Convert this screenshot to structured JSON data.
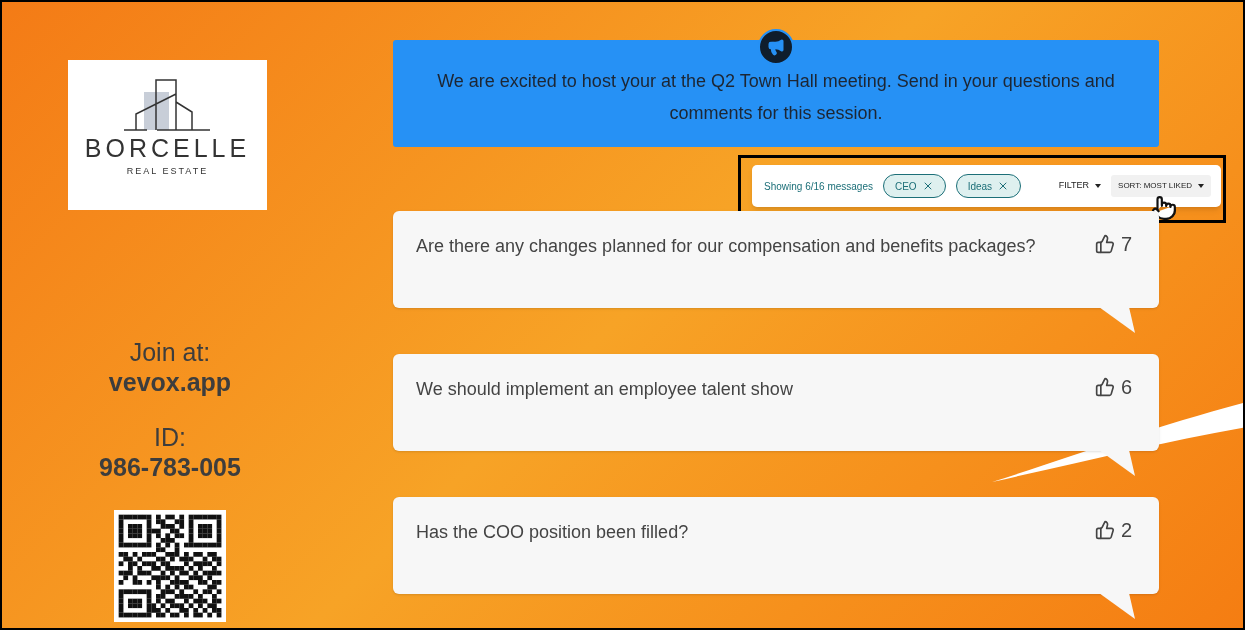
{
  "logo": {
    "name": "BORCELLE",
    "tagline": "REAL ESTATE"
  },
  "join": {
    "label": "Join at:",
    "url": "vevox.app",
    "id_label": "ID:",
    "id_value": "986-783-005"
  },
  "banner": {
    "text": "We are excited to host your at the Q2 Town Hall meeting. Send in your questions and comments for this session."
  },
  "toolbar": {
    "highlighted": true,
    "count": "Showing 6/16 messages",
    "chips": [
      {
        "label": "CEO"
      },
      {
        "label": "Ideas"
      }
    ],
    "filter": "FILTER",
    "sort": "SORT: MOST LIKED"
  },
  "messages": [
    {
      "text": "Are there any changes planned for our compensation and benefits packages?",
      "likes": "7"
    },
    {
      "text": "We should implement an employee talent show",
      "likes": "6"
    },
    {
      "text": "Has the COO position been filled?",
      "likes": "2"
    }
  ]
}
